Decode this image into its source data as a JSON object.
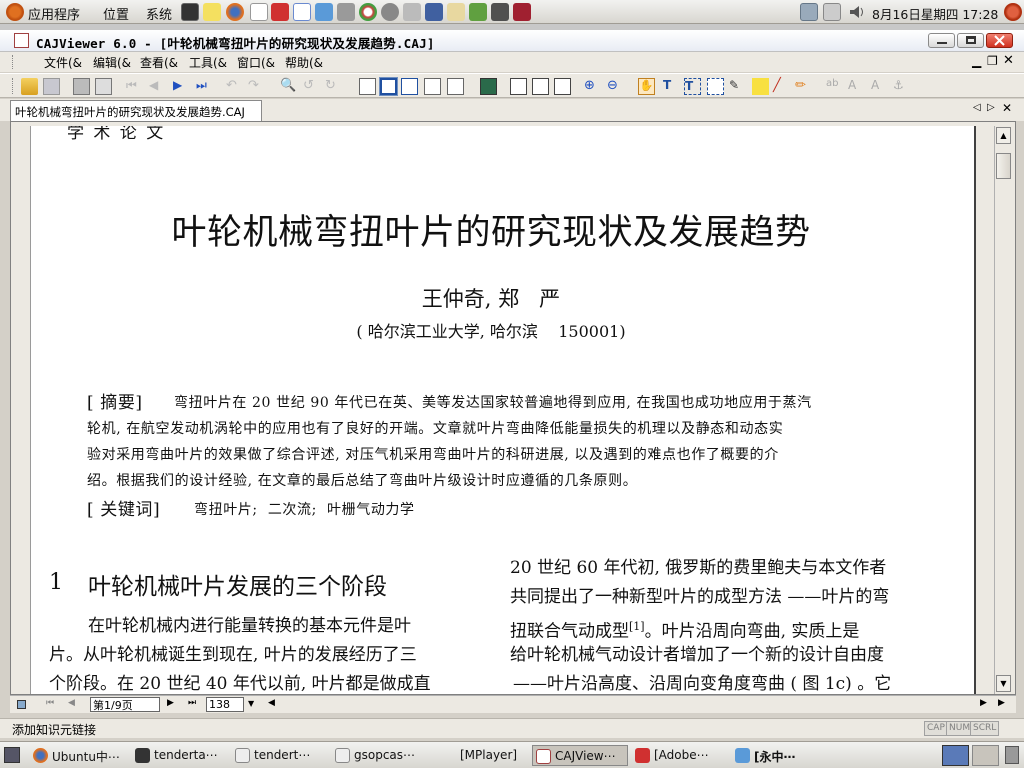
{
  "top_panel": {
    "menus": [
      "应用程序",
      "位置",
      "系统"
    ],
    "date_time": "8月16日星期四  17:28"
  },
  "window": {
    "title": "CAJViewer 6.0 - [叶轮机械弯扭叶片的研究现状及发展趋势.CAJ]"
  },
  "menu": [
    "文件(&",
    "编辑(&",
    "查看(&",
    "工具(&",
    "窗口(&",
    "帮助(&"
  ],
  "tab": {
    "label": "叶轮机械弯扭叶片的研究现状及发展趋势.CAJ"
  },
  "document": {
    "header_label": "学 术 论 文",
    "title": "叶轮机械弯扭叶片的研究现状及发展趋势",
    "authors": "王仲奇, 郑   严",
    "affiliation": "( 哈尔滨工业大学, 哈尔滨    150001)",
    "abstract_label": "[ 摘要]",
    "abstract_lines": [
      "弯扭叶片在 20 世纪 90 年代已在英、美等发达国家较普遍地得到应用, 在我国也成功地应用于蒸汽",
      "轮机, 在航空发动机涡轮中的应用也有了良好的开端。文章就叶片弯曲降低能量损失的机理以及静态和动态实",
      "验对采用弯曲叶片的效果做了综合评述, 对压气机采用弯曲叶片的科研进展, 以及遇到的难点也作了概要的介",
      "绍。根据我们的设计经验, 在文章的最后总结了弯曲叶片级设计时应遵循的几条原则。"
    ],
    "keywords_label": "[ 关键词]",
    "keywords": "弯扭叶片;  二次流;  叶栅气动力学",
    "section_num": "1",
    "section_title": "叶轮机械叶片发展的三个阶段",
    "left_col": [
      "在叶轮机械内进行能量转换的基本元件是叶",
      "片。从叶轮机械诞生到现在, 叶片的发展经历了三",
      "个阶段。在 20 世纪 40 年代以前, 叶片都是做成直"
    ],
    "right_col": [
      "20 世纪 60 年代初, 俄罗斯的费里鲍夫与本文作者",
      "共同提出了一种新型叶片的成型方法 ——叶片的弯",
      "扭联合气动成型",
      "。叶片沿周向弯曲, 实质上是",
      "给叶轮机械气动设计者增加了一个新的设计自由度",
      "——叶片沿高度、沿周向变角度弯曲  ( 图 1c) 。它"
    ],
    "citation": "[1]"
  },
  "navigation": {
    "page_field": "第1/9页",
    "zoom_field": "138"
  },
  "status": {
    "text": "添加知识元链接",
    "indicators": [
      "CAP",
      "NUM",
      "SCRL"
    ]
  },
  "taskbar": {
    "items": [
      "Ubuntu中⋯",
      "tenderta⋯",
      "tendert⋯",
      "gsopcas⋯",
      "[MPlayer]",
      "CAJView⋯",
      "[Adobe⋯",
      "[永中⋯"
    ]
  },
  "colors": {
    "title_bar_gradient_top": "#ffffff",
    "close_button": "#e04030",
    "page_background": "#ffffff",
    "chrome": "#ece9e2"
  }
}
